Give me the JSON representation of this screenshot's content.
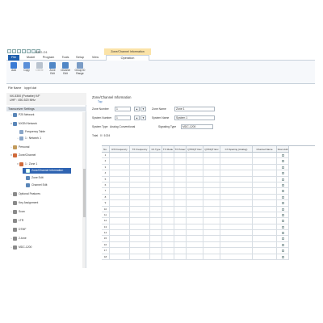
{
  "window": {
    "app_title": "KPG-D1",
    "context_title": "Zone/Channel Information"
  },
  "tabs": [
    "File",
    "Model",
    "Program",
    "Tools",
    "Setup",
    "View",
    "Operation"
  ],
  "ribbon": {
    "buttons": [
      {
        "label": "Add",
        "disabled": false,
        "color": "#3a7bd5"
      },
      {
        "label": "Copy",
        "disabled": false,
        "color": "#5a8fd8"
      },
      {
        "label": "Delete",
        "disabled": true,
        "color": "#b9c3cf"
      },
      {
        "label": "Zone\nEdit",
        "disabled": false,
        "color": "#4f86c6"
      },
      {
        "label": "Channel\nEdit",
        "disabled": false,
        "color": "#4f86c6"
      },
      {
        "label": "Group ID\nRange",
        "disabled": false,
        "color": "#7a9cc6"
      }
    ]
  },
  "file": {
    "label": "File Name",
    "value": "kpgxf.dat"
  },
  "device": {
    "model": "NX-5300 (Portable) K/F",
    "band": "UHF : 450-520 MHz"
  },
  "tree_header": "Transceiver Settings",
  "tree": [
    {
      "label": "P25 Network",
      "level": 0,
      "arrow": ">",
      "icon": "network-icon",
      "color": "#5a86b8"
    },
    {
      "label": "NXDN Network",
      "level": 0,
      "arrow": "v",
      "icon": "network-icon",
      "color": "#5a86b8"
    },
    {
      "label": "Frequency Table",
      "level": 1,
      "arrow": "",
      "icon": "table-icon",
      "color": "#8aa6c8"
    },
    {
      "label": "1 : Network 1",
      "level": 1,
      "arrow": ">",
      "icon": "network-icon",
      "color": "#8aa6c8"
    },
    {
      "label": "Personal",
      "level": 0,
      "arrow": ">",
      "icon": "person-icon",
      "color": "#c29a5a"
    },
    {
      "label": "Zone/Channel",
      "level": 0,
      "arrow": "v",
      "icon": "zone-icon",
      "color": "#d06a3a"
    },
    {
      "label": "1 : Zone 1",
      "level": 1,
      "arrow": "v",
      "icon": "zone-icon",
      "color": "#d06a3a"
    },
    {
      "label": "Zone/Channel Information",
      "level": 2,
      "arrow": "",
      "icon": "info-icon",
      "color": "#ffffff",
      "selected": true
    },
    {
      "label": "Zone Edit",
      "level": 2,
      "arrow": "",
      "icon": "edit-icon",
      "color": "#5a86b8"
    },
    {
      "label": "Channel Edit",
      "level": 2,
      "arrow": "",
      "icon": "edit-icon",
      "color": "#5a86b8"
    },
    {
      "label": "Optional Features",
      "level": 0,
      "arrow": ">",
      "icon": "gear-icon",
      "color": "#8a8a8a"
    },
    {
      "label": "Key Assignment",
      "level": 0,
      "arrow": "",
      "icon": "key-icon",
      "color": "#8a8a8a"
    },
    {
      "label": "Scan",
      "level": 0,
      "arrow": ">",
      "icon": "scan-icon",
      "color": "#8a8a8a"
    },
    {
      "label": "LTR",
      "level": 0,
      "arrow": "",
      "icon": "ltr-icon",
      "color": "#8a8a8a"
    },
    {
      "label": "DTMF",
      "level": 0,
      "arrow": "",
      "icon": "dtmf-icon",
      "color": "#8a8a8a"
    },
    {
      "label": "2-tone",
      "level": 0,
      "arrow": ">",
      "icon": "tone-icon",
      "color": "#8a8a8a"
    },
    {
      "label": "MDC-1200",
      "level": 0,
      "arrow": ">",
      "icon": "mdc-icon",
      "color": "#8a8a8a"
    }
  ],
  "panel": {
    "title": "Zone/Channel Information",
    "sub": "Top",
    "zone_number_label": "Zone Number",
    "zone_number": "1",
    "zone_name_label": "Zone Name",
    "zone_name": "Zone 1",
    "system_number_label": "System Number",
    "system_number": "1",
    "system_name_label": "System Name",
    "system_name": "System 1",
    "system_type_label": "System Type",
    "system_type": "Analog Conventional",
    "signaling_type_label": "Signaling Type",
    "signaling_type": "MDC-1200",
    "total_label": "Total",
    "total": "0 / 1024"
  },
  "table": {
    "headers": [
      "No.",
      "RX Frequency",
      "TX Frequency",
      "Ch Type",
      "TX Mode",
      "TX Power",
      "QT/DQT Dec",
      "QT/DQT Enc",
      "Ch Spacing (Analog)",
      "Channel Name",
      "Scan Add"
    ],
    "rows": [
      "1",
      "2",
      "3",
      "4",
      "5",
      "6",
      "7",
      "8",
      "9",
      "10",
      "11",
      "12",
      "13",
      "14",
      "15",
      "16",
      "17",
      "18"
    ]
  }
}
